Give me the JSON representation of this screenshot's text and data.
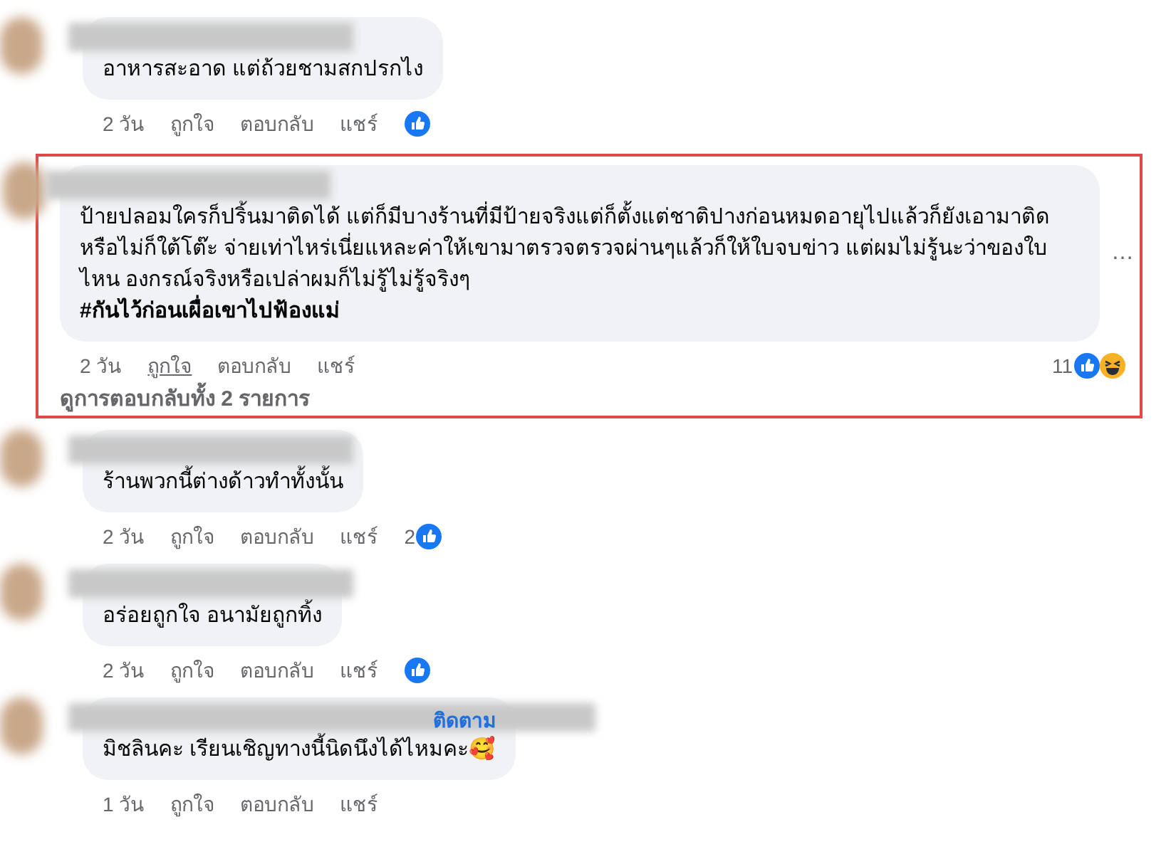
{
  "comments": [
    {
      "text": "อาหารสะอาด แต่ถ้วยชามสกปรกไง",
      "time": "2 วัน",
      "like": "ถูกใจ",
      "reply": "ตอบกลับ",
      "share": "แชร์",
      "like_hovered": false,
      "highlighted": false,
      "reactions": [
        {
          "kind": "like"
        }
      ]
    },
    {
      "text": "ป้ายปลอมใครก็ปริ้นมาติดได้ แต่ก็มีบางร้านที่มีป้ายจริงแต่ก็ตั้งแต่ชาติปางก่อนหมดอายุไปแล้วก็ยังเอามาติด หรือไม่ก็ใต้โต๊ะ จ่ายเท่าไหร่เนี่ยแหละค่าให้เขามาตรวจตรวจผ่านๆแล้วก็ให้ใบจบข่าว แต่ผมไม่รู้นะว่าของใบไหน องกรณ์จริงหรือเปล่าผมก็ไม่รู้ไม่รู้จริงๆ",
      "hashtag": "#กันไว้ก่อนเผื่อเขาไปฟ้องแม่",
      "time": "2 วัน",
      "like": "ถูกใจ",
      "reply": "ตอบกลับ",
      "share": "แชร์",
      "like_hovered": true,
      "highlighted": true,
      "reaction_count": "11",
      "reactions": [
        {
          "kind": "like"
        },
        {
          "kind": "haha"
        }
      ],
      "more": "…",
      "view_replies": "ดูการตอบกลับทั้ง 2 รายการ"
    },
    {
      "text": "ร้านพวกนี้ต่างด้าวทำทั้งนั้น",
      "time": "2 วัน",
      "like": "ถูกใจ",
      "reply": "ตอบกลับ",
      "share": "แชร์",
      "like_hovered": false,
      "highlighted": false,
      "reaction_count": "2",
      "reactions": [
        {
          "kind": "like"
        }
      ]
    },
    {
      "text": "อร่อยถูกใจ อนามัยถูกทิ้ง",
      "time": "2 วัน",
      "like": "ถูกใจ",
      "reply": "ตอบกลับ",
      "share": "แชร์",
      "like_hovered": false,
      "highlighted": false,
      "reactions": [
        {
          "kind": "like"
        }
      ]
    },
    {
      "follow": "ติดตาม",
      "text": "มิชลินคะ เรียนเชิญทางนี้นิดนึงได้ไหมคะ",
      "emoji": "🥰",
      "time": "1 วัน",
      "like": "ถูกใจ",
      "reply": "ตอบกลับ",
      "share": "แชร์",
      "like_hovered": false,
      "highlighted": false
    }
  ]
}
